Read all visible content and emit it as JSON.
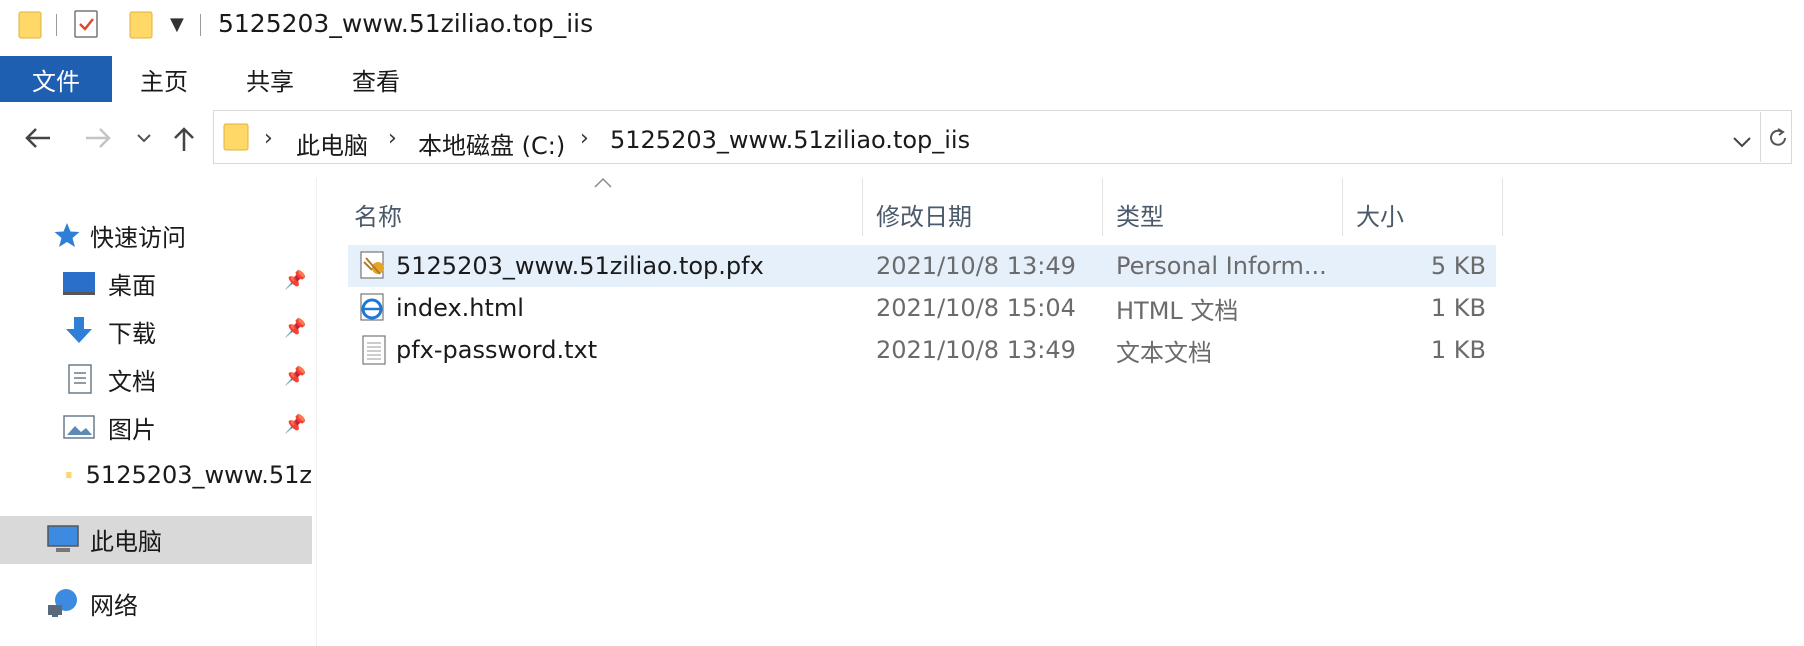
{
  "window": {
    "title": "5125203_www.51ziliao.top_iis"
  },
  "ribbon": {
    "tabs": [
      "文件",
      "主页",
      "共享",
      "查看"
    ]
  },
  "address": {
    "crumbs": [
      "此电脑",
      "本地磁盘 (C:)",
      "5125203_www.51ziliao.top_iis"
    ]
  },
  "sidebar": {
    "quick_access": "快速访问",
    "items": [
      {
        "label": "桌面",
        "icon": "desktop-icon",
        "pinned": true
      },
      {
        "label": "下载",
        "icon": "download-icon",
        "pinned": true
      },
      {
        "label": "文档",
        "icon": "document-icon",
        "pinned": true
      },
      {
        "label": "图片",
        "icon": "pictures-icon",
        "pinned": true
      },
      {
        "label": "5125203_www.51z",
        "icon": "folder-icon",
        "pinned": false
      }
    ],
    "this_pc": "此电脑",
    "network": "网络"
  },
  "columns": {
    "name": "名称",
    "date": "修改日期",
    "type": "类型",
    "size": "大小"
  },
  "files": [
    {
      "name": "5125203_www.51ziliao.top.pfx",
      "date": "2021/10/8 13:49",
      "type": "Personal Inform...",
      "size": "5 KB",
      "icon": "certificate-icon",
      "selected": true
    },
    {
      "name": "index.html",
      "date": "2021/10/8 15:04",
      "type": "HTML 文档",
      "size": "1 KB",
      "icon": "edge-html-icon",
      "selected": false
    },
    {
      "name": "pfx-password.txt",
      "date": "2021/10/8 13:49",
      "type": "文本文档",
      "size": "1 KB",
      "icon": "text-file-icon",
      "selected": false
    }
  ],
  "colors": {
    "accent": "#1f5fb2",
    "selection": "#e6f0fb",
    "nav_selected": "#d9d9d9"
  }
}
